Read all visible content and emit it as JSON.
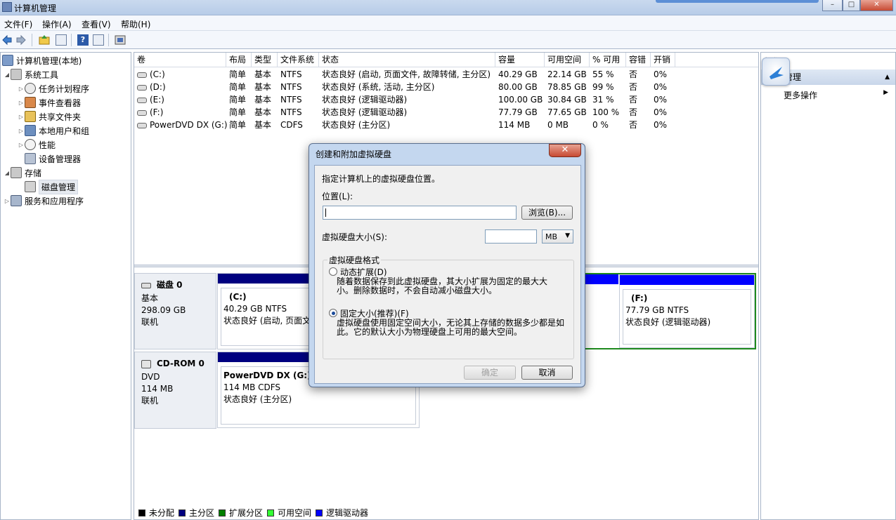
{
  "window": {
    "title": "计算机管理",
    "buttons": [
      "–",
      "□",
      "✕"
    ]
  },
  "menu": [
    "文件(F)",
    "操作(A)",
    "查看(V)",
    "帮助(H)"
  ],
  "tree": {
    "root": "计算机管理(本地)",
    "items": [
      {
        "label": "系统工具",
        "level": 1,
        "expanded": true
      },
      {
        "label": "任务计划程序",
        "level": 2
      },
      {
        "label": "事件查看器",
        "level": 2
      },
      {
        "label": "共享文件夹",
        "level": 2
      },
      {
        "label": "本地用户和组",
        "level": 2
      },
      {
        "label": "性能",
        "level": 2
      },
      {
        "label": "设备管理器",
        "level": 2
      },
      {
        "label": "存储",
        "level": 1,
        "expanded": true
      },
      {
        "label": "磁盘管理",
        "level": 2,
        "selected": true
      },
      {
        "label": "服务和应用程序",
        "level": 1
      }
    ]
  },
  "volumes": {
    "headers": [
      "卷",
      "布局",
      "类型",
      "文件系统",
      "状态",
      "容量",
      "可用空间",
      "% 可用",
      "容错",
      "开销"
    ],
    "rows": [
      [
        "(C:)",
        "简单",
        "基本",
        "NTFS",
        "状态良好 (启动, 页面文件, 故障转储, 主分区)",
        "40.29 GB",
        "22.14 GB",
        "55 %",
        "否",
        "0%"
      ],
      [
        "(D:)",
        "简单",
        "基本",
        "NTFS",
        "状态良好 (系统, 活动, 主分区)",
        "80.00 GB",
        "78.85 GB",
        "99 %",
        "否",
        "0%"
      ],
      [
        "(E:)",
        "简单",
        "基本",
        "NTFS",
        "状态良好 (逻辑驱动器)",
        "100.00 GB",
        "30.84 GB",
        "31 %",
        "否",
        "0%"
      ],
      [
        "(F:)",
        "简单",
        "基本",
        "NTFS",
        "状态良好 (逻辑驱动器)",
        "77.79 GB",
        "77.65 GB",
        "100 %",
        "否",
        "0%"
      ],
      [
        "PowerDVD DX (G:)",
        "简单",
        "基本",
        "CDFS",
        "状态良好 (主分区)",
        "114 MB",
        "0 MB",
        "0 %",
        "否",
        "0%"
      ]
    ]
  },
  "disks": [
    {
      "name": "磁盘 0",
      "type": "基本",
      "size": "298.09 GB",
      "state": "联机",
      "partitions": [
        {
          "label": "(C:)",
          "size": "40.29 GB NTFS",
          "status": "状态良好 (启动, 页面文"
        },
        {
          "label": "(F:)",
          "size": "77.79 GB NTFS",
          "status": "状态良好 (逻辑驱动器)"
        }
      ]
    },
    {
      "name": "CD-ROM 0",
      "type": "DVD",
      "size": "114 MB",
      "state": "联机",
      "partitions": [
        {
          "label": "PowerDVD DX  (G:)",
          "size": "114 MB CDFS",
          "status": "状态良好 (主分区)"
        }
      ]
    }
  ],
  "legend": [
    {
      "label": "未分配",
      "color": "#000000"
    },
    {
      "label": "主分区",
      "color": "#000080"
    },
    {
      "label": "扩展分区",
      "color": "#008000"
    },
    {
      "label": "可用空间",
      "color": "#33ff33"
    },
    {
      "label": "逻辑驱动器",
      "color": "#0000ff"
    }
  ],
  "actions": {
    "header": "操作",
    "section": "管理",
    "more": "更多操作"
  },
  "dialog": {
    "title": "创建和附加虚拟硬盘",
    "instruction": "指定计算机上的虚拟硬盘位置。",
    "location_label": "位置(L):",
    "location_value": "",
    "browse": "浏览(B)...",
    "size_label": "虚拟硬盘大小(S):",
    "size_value": "",
    "unit": "MB",
    "format_group": "虚拟硬盘格式",
    "dynamic_label": "动态扩展(D)",
    "dynamic_desc": "随着数据保存到此虚拟硬盘，其大小扩展为固定的最大大小。删除数据时，不会自动减小磁盘大小。",
    "fixed_label": "固定大小(推荐)(F)",
    "fixed_desc": "虚拟硬盘使用固定空间大小，无论其上存储的数据多少都是如此。它的默认大小为物理硬盘上可用的最大空间。",
    "ok": "确定",
    "cancel": "取消"
  }
}
